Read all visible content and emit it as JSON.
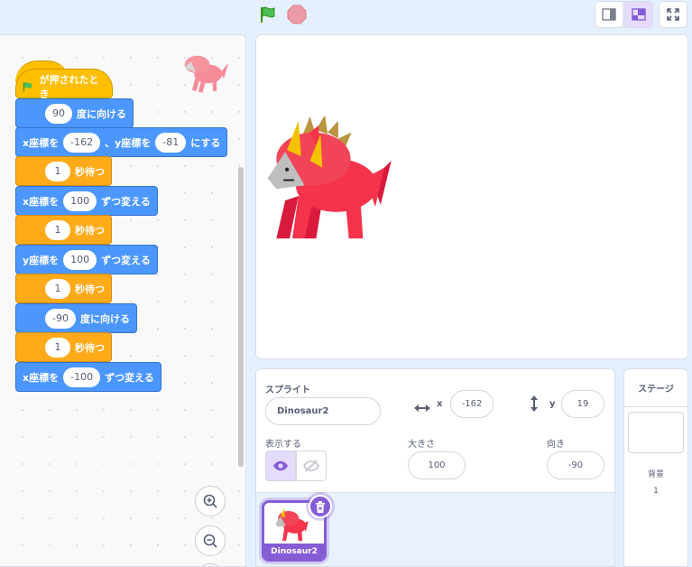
{
  "colors": {
    "motion": "#4c97ff",
    "control": "#ffab19",
    "events": "#ffbf00",
    "accent": "#855cd6",
    "dino_body": "#f5334b"
  },
  "icons": {
    "flag": "green-flag-icon",
    "stop": "stop-icon",
    "zoom_in": "zoom-in-icon",
    "zoom_out": "zoom-out-icon"
  },
  "blocks": {
    "hat": "が押されたとき",
    "b1": {
      "value": "90",
      "text": "度に向ける"
    },
    "b2": {
      "pre": "x座標を",
      "x": "-162",
      "mid": "、y座標を",
      "y": "-81",
      "post": "にする"
    },
    "b3": {
      "value": "1",
      "text": "秒待つ"
    },
    "b4": {
      "pre": "x座標を",
      "value": "100",
      "post": "ずつ変える"
    },
    "b5": {
      "value": "1",
      "text": "秒待つ"
    },
    "b6": {
      "pre": "y座標を",
      "value": "100",
      "post": "ずつ変える"
    },
    "b7": {
      "value": "1",
      "text": "秒待つ"
    },
    "b8": {
      "value": "-90",
      "text": "度に向ける"
    },
    "b9": {
      "value": "1",
      "text": "秒待つ"
    },
    "b10": {
      "pre": "x座標を",
      "value": "-100",
      "post": "ずつ変える"
    }
  },
  "sprite_info": {
    "sprite_label": "スプライト",
    "sprite_name": "Dinosaur2",
    "x_label": "x",
    "x_value": "-162",
    "y_label": "y",
    "y_value": "19",
    "show_label": "表示する",
    "size_label": "大きさ",
    "size_value": "100",
    "direction_label": "向き",
    "direction_value": "-90"
  },
  "sprite_list": {
    "tile_name": "Dinosaur2"
  },
  "stage_panel": {
    "title": "ステージ",
    "backdrop_label": "背景",
    "backdrop_count": "1"
  }
}
